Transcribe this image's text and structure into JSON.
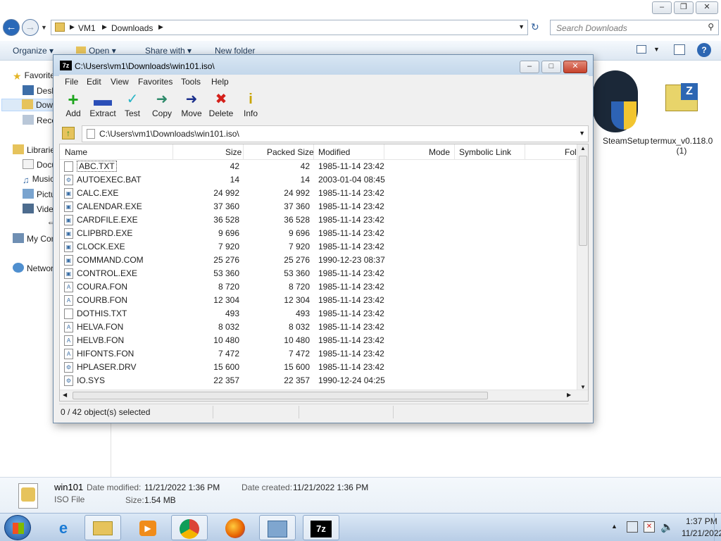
{
  "explorer": {
    "address": {
      "crumb1": "VM1",
      "crumb2": "Downloads"
    },
    "search_placeholder": "Search Downloads",
    "cmdbar": {
      "organize": "Organize",
      "open": "Open",
      "share_with": "Share with",
      "new_folder": "New folder"
    },
    "nav": {
      "favorites": "Favorites",
      "desktop": "Desktop",
      "downloads": "Downloads",
      "recent": "Recent Places",
      "libraries": "Libraries",
      "documents": "Documents",
      "music": "Music",
      "pictures": "Pictures",
      "videos": "Videos",
      "computer": "My Computer",
      "network": "Network"
    },
    "files": [
      {
        "label": "SteamSetup"
      },
      {
        "label": "termux_v0.118.0 (1)"
      }
    ],
    "details": {
      "name": "win101",
      "type": "ISO File",
      "modified_label": "Date modified:",
      "modified": "11/21/2022 1:36 PM",
      "created_label": "Date created:",
      "created": "11/21/2022 1:36 PM",
      "size_label": "Size:",
      "size": "1.54 MB"
    }
  },
  "sevenzip": {
    "title": "C:\\Users\\vm1\\Downloads\\win101.iso\\",
    "menu": [
      "File",
      "Edit",
      "View",
      "Favorites",
      "Tools",
      "Help"
    ],
    "toolbar": [
      "Add",
      "Extract",
      "Test",
      "Copy",
      "Move",
      "Delete",
      "Info"
    ],
    "path": "C:\\Users\\vm1\\Downloads\\win101.iso\\",
    "columns": {
      "name": "Name",
      "size": "Size",
      "packed": "Packed Size",
      "modified": "Modified",
      "mode": "Mode",
      "symlink": "Symbolic Link",
      "folder": "Fol"
    },
    "rows": [
      {
        "name": "ABC.TXT",
        "size": "42",
        "packed": "42",
        "modified": "1985-11-14 23:42",
        "icon": "txt"
      },
      {
        "name": "AUTOEXEC.BAT",
        "size": "14",
        "packed": "14",
        "modified": "2003-01-04 08:45",
        "icon": "bat"
      },
      {
        "name": "CALC.EXE",
        "size": "24 992",
        "packed": "24 992",
        "modified": "1985-11-14 23:42",
        "icon": "exe"
      },
      {
        "name": "CALENDAR.EXE",
        "size": "37 360",
        "packed": "37 360",
        "modified": "1985-11-14 23:42",
        "icon": "exe"
      },
      {
        "name": "CARDFILE.EXE",
        "size": "36 528",
        "packed": "36 528",
        "modified": "1985-11-14 23:42",
        "icon": "exe"
      },
      {
        "name": "CLIPBRD.EXE",
        "size": "9 696",
        "packed": "9 696",
        "modified": "1985-11-14 23:42",
        "icon": "exe"
      },
      {
        "name": "CLOCK.EXE",
        "size": "7 920",
        "packed": "7 920",
        "modified": "1985-11-14 23:42",
        "icon": "exe"
      },
      {
        "name": "COMMAND.COM",
        "size": "25 276",
        "packed": "25 276",
        "modified": "1990-12-23 08:37",
        "icon": "exe"
      },
      {
        "name": "CONTROL.EXE",
        "size": "53 360",
        "packed": "53 360",
        "modified": "1985-11-14 23:42",
        "icon": "exe"
      },
      {
        "name": "COURA.FON",
        "size": "8 720",
        "packed": "8 720",
        "modified": "1985-11-14 23:42",
        "icon": "fon"
      },
      {
        "name": "COURB.FON",
        "size": "12 304",
        "packed": "12 304",
        "modified": "1985-11-14 23:42",
        "icon": "fon"
      },
      {
        "name": "DOTHIS.TXT",
        "size": "493",
        "packed": "493",
        "modified": "1985-11-14 23:42",
        "icon": "txt"
      },
      {
        "name": "HELVA.FON",
        "size": "8 032",
        "packed": "8 032",
        "modified": "1985-11-14 23:42",
        "icon": "fon"
      },
      {
        "name": "HELVB.FON",
        "size": "10 480",
        "packed": "10 480",
        "modified": "1985-11-14 23:42",
        "icon": "fon"
      },
      {
        "name": "HIFONTS.FON",
        "size": "7 472",
        "packed": "7 472",
        "modified": "1985-11-14 23:42",
        "icon": "fon"
      },
      {
        "name": "HPLASER.DRV",
        "size": "15 600",
        "packed": "15 600",
        "modified": "1985-11-14 23:42",
        "icon": "drv"
      },
      {
        "name": "IO.SYS",
        "size": "22 357",
        "packed": "22 357",
        "modified": "1990-12-24 04:25",
        "icon": "sys"
      }
    ],
    "status": "0 / 42 object(s) selected"
  },
  "taskbar": {
    "clock_time": "1:37 PM",
    "clock_date": "11/21/2022"
  },
  "colors": {
    "accent": "#3a6ea5",
    "selection": "#dceaf8",
    "taskbar": "#c9dbef"
  }
}
